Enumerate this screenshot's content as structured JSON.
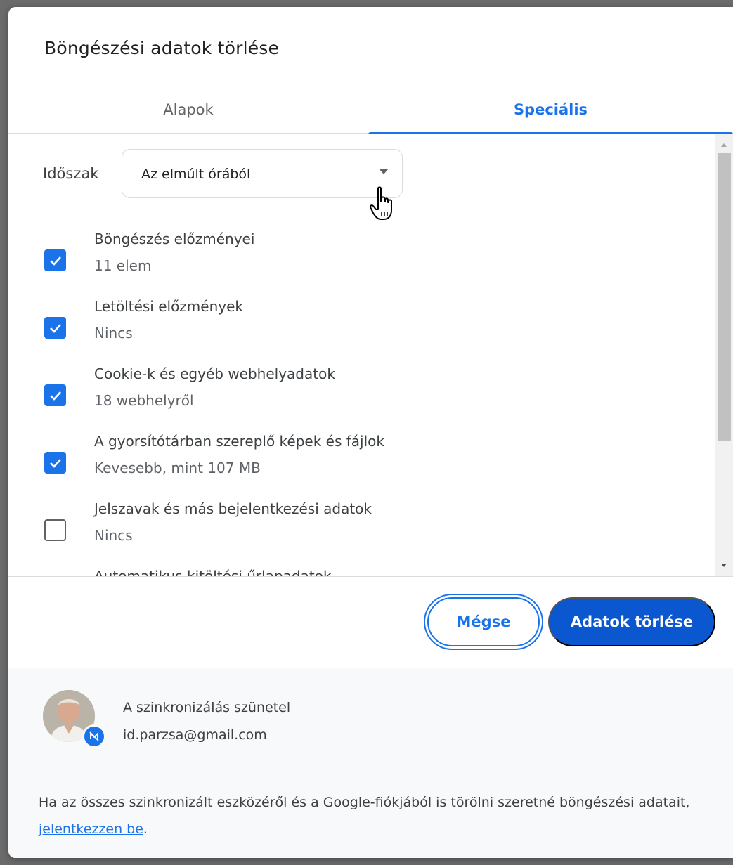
{
  "dialog": {
    "title": "Böngészési adatok törlése"
  },
  "tabs": [
    {
      "label": "Alapok",
      "selected": false
    },
    {
      "label": "Speciális",
      "selected": true
    }
  ],
  "time_range": {
    "label": "Időszak",
    "value": "Az elmúlt órából"
  },
  "items": [
    {
      "title": "Böngészés előzményei",
      "subtitle": "11 elem",
      "checked": true
    },
    {
      "title": "Letöltési előzmények",
      "subtitle": "Nincs",
      "checked": true
    },
    {
      "title": "Cookie-k és egyéb webhelyadatok",
      "subtitle": "18 webhelyről",
      "checked": true
    },
    {
      "title": "A gyorsítótárban szereplő képek és fájlok",
      "subtitle": "Kevesebb, mint 107 MB",
      "checked": true
    },
    {
      "title": "Jelszavak és más bejelentkezési adatok",
      "subtitle": "Nincs",
      "checked": false
    },
    {
      "title": "Automatikus kitöltési űrlapadatok",
      "subtitle": "",
      "checked": false
    }
  ],
  "buttons": {
    "cancel": "Mégse",
    "clear": "Adatok törlése"
  },
  "account": {
    "sync_status": "A szinkronizálás szünetel",
    "email": "id.parzsa@gmail.com"
  },
  "footer": {
    "info_text": "Ha az összes szinkronizált eszközéről és a Google-fiókjából is törölni szeretné böngészési adatait,",
    "link_text": "jelentkezzen be",
    "info_end": "."
  },
  "colors": {
    "accent": "#1a73e8",
    "primary_button": "#0b57d0"
  }
}
